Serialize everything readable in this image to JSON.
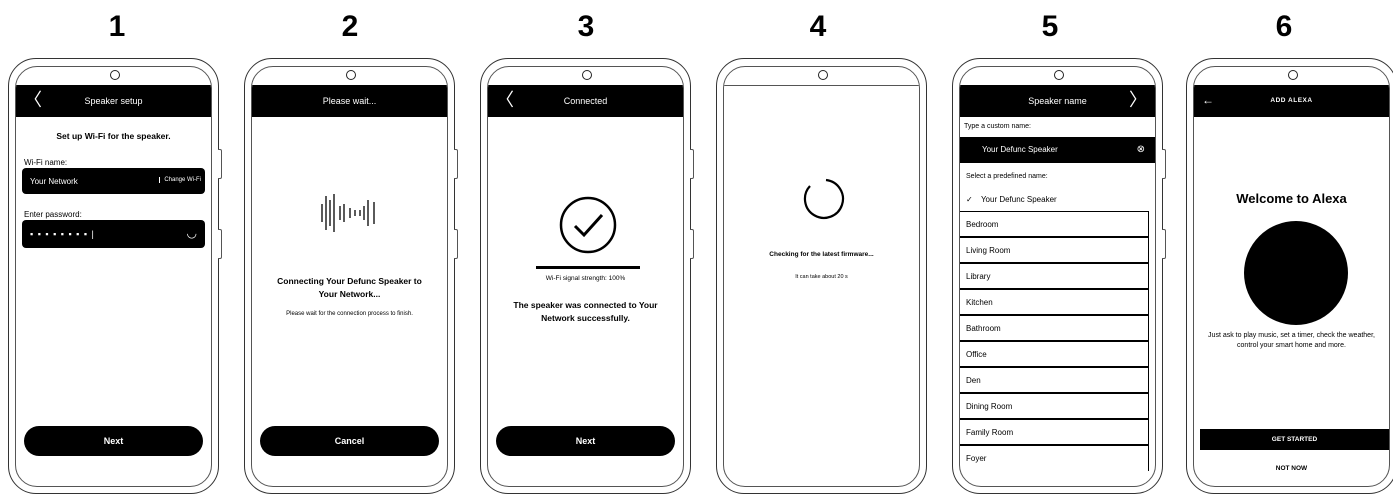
{
  "steps": [
    {
      "num": "1"
    },
    {
      "num": "2"
    },
    {
      "num": "3"
    },
    {
      "num": "4"
    },
    {
      "num": "5"
    },
    {
      "num": "6"
    }
  ],
  "screen1": {
    "title": "Speaker setup",
    "heading": "Set up Wi-Fi for the speaker.",
    "wifi_label": "Wi-Fi name:",
    "wifi_value": "Your Network",
    "change_wifi": "Change Wi-Fi",
    "password_label": "Enter password:",
    "password_mask": "▪ ▪ ▪ ▪ ▪ ▪ ▪ ▪  |",
    "next": "Next"
  },
  "screen2": {
    "title": "Please wait...",
    "connecting": "Connecting Your Defunc Speaker to Your Network...",
    "wait_note": "Please wait for the connection process to finish.",
    "cancel": "Cancel"
  },
  "screen3": {
    "title": "Connected",
    "signal": "Wi-Fi signal strength: 100%",
    "signal_strength": 1.0,
    "success": "The speaker was connected to Your Network successfully.",
    "next": "Next"
  },
  "screen4": {
    "checking": "Checking for the latest firmware...",
    "duration": "It can take about 20 s"
  },
  "screen5": {
    "title": "Speaker name",
    "custom_label": "Type a custom name:",
    "custom_value": "Your Defunc Speaker",
    "predefined_label": "Select a predefined name:",
    "selected": "Your Defunc Speaker",
    "names": [
      "Bedroom",
      "Living Room",
      "Library",
      "Kitchen",
      "Bathroom",
      "Office",
      "Den",
      "Dining Room",
      "Family Room",
      "Foyer"
    ]
  },
  "screen6": {
    "title": "ADD ALEXA",
    "welcome": "Welcome to Alexa",
    "description": "Just ask to play music, set a timer, check the weather, control your smart home and more.",
    "get_started": "GET STARTED",
    "not_now": "NOT NOW"
  }
}
